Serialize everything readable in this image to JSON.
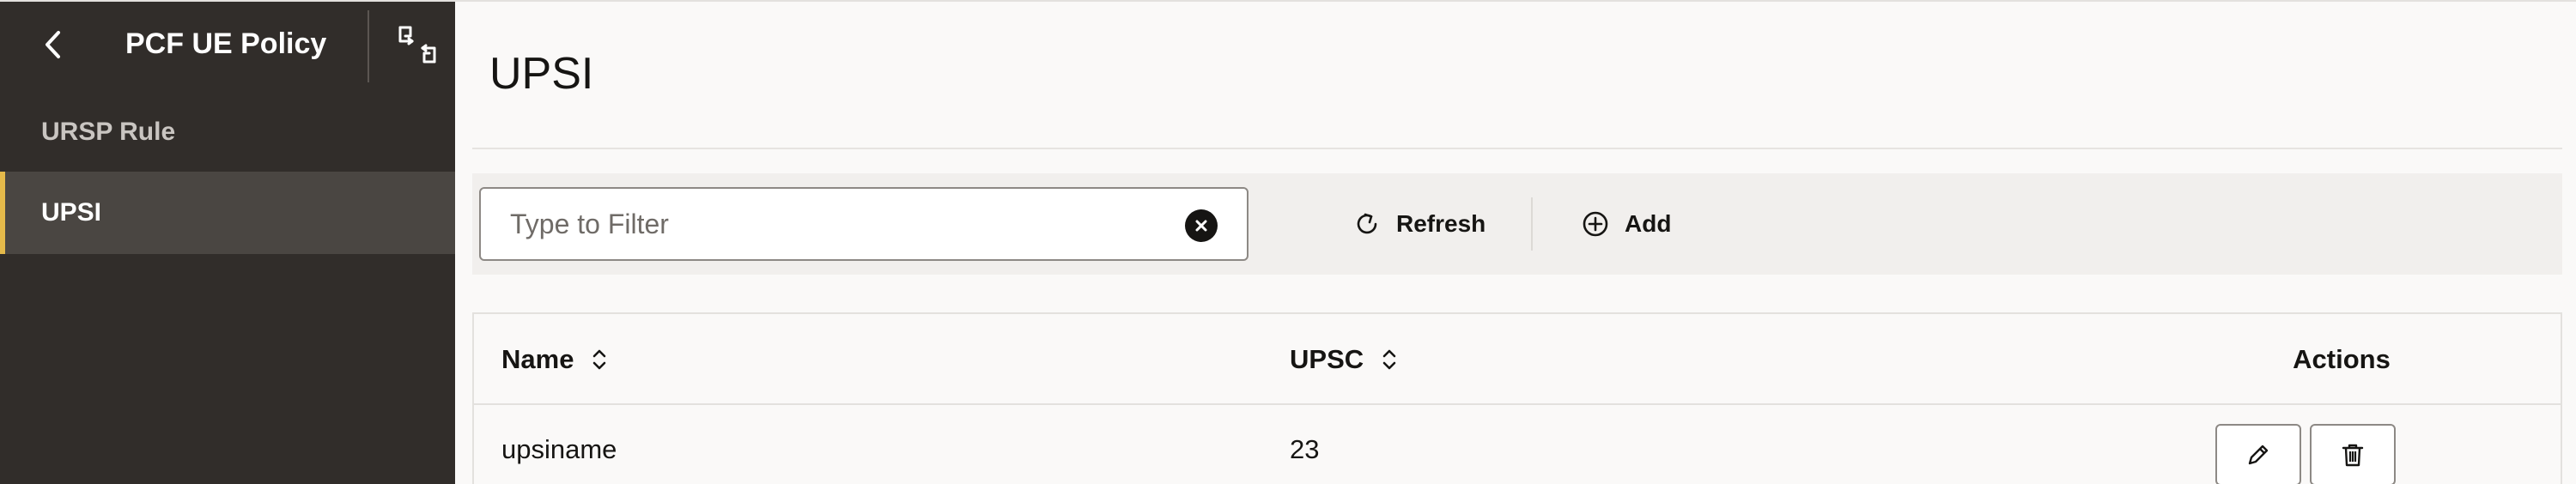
{
  "colors": {
    "sidebar_bg": "#312d2a",
    "sidebar_active_bg": "#4a4642",
    "sidebar_active_indicator": "#e4b94a",
    "main_bg": "#faf9f8",
    "toolbar_bg": "#f1efed",
    "text": "#161513"
  },
  "sidebar": {
    "back_icon": "chevron-left-icon",
    "title": "PCF UE Policy",
    "switch_icon": "switch-view-icon",
    "items": [
      {
        "label": "URSP Rule",
        "active": false
      },
      {
        "label": "UPSI",
        "active": true
      }
    ]
  },
  "main": {
    "title": "UPSI",
    "toolbar": {
      "filter": {
        "placeholder": "Type to Filter",
        "value": "",
        "clear_icon": "clear-circle-icon"
      },
      "refresh_label": "Refresh",
      "refresh_icon": "refresh-icon",
      "add_label": "Add",
      "add_icon": "plus-circle-icon"
    },
    "table": {
      "columns": [
        {
          "label": "Name",
          "sortable": true
        },
        {
          "label": "UPSC",
          "sortable": true
        },
        {
          "label": "Actions",
          "sortable": false
        }
      ],
      "rows": [
        {
          "name": "upsiname",
          "upsc": "23"
        }
      ],
      "row_action_icons": [
        "pencil-icon",
        "trash-icon"
      ]
    }
  }
}
